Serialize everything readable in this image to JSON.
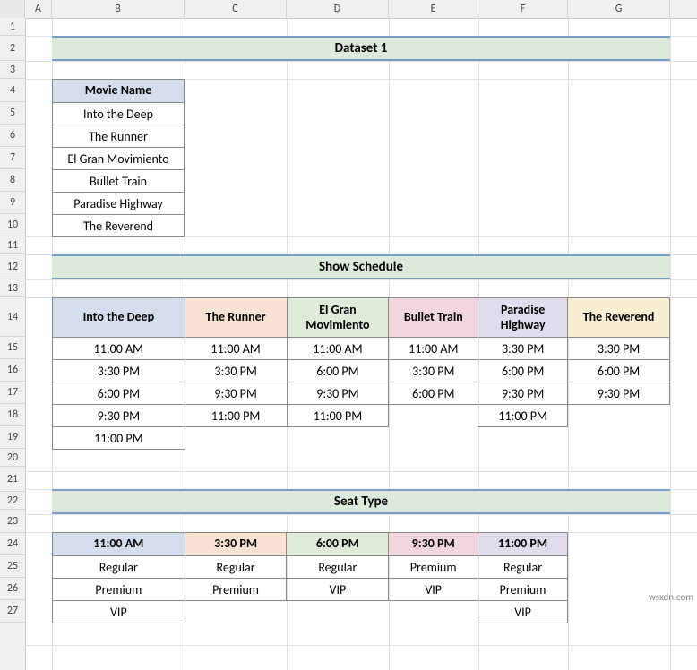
{
  "columns": [
    "A",
    "B",
    "C",
    "D",
    "E",
    "F",
    "G"
  ],
  "rows": [
    "1",
    "2",
    "3",
    "4",
    "5",
    "6",
    "7",
    "8",
    "9",
    "10",
    "11",
    "12",
    "13",
    "14",
    "15",
    "16",
    "17",
    "18",
    "19",
    "20",
    "21",
    "22",
    "23",
    "24",
    "25",
    "26",
    "27"
  ],
  "section1": {
    "title": "Dataset 1"
  },
  "movieNameHeader": "Movie Name",
  "movies": [
    "Into the Deep",
    "The Runner",
    "El Gran Movimiento",
    "Bullet Train",
    "Paradise Highway",
    "The Reverend"
  ],
  "section2": {
    "title": "Show Schedule"
  },
  "schedule": {
    "headers": [
      "Into the Deep",
      "The Runner",
      "El Gran Movimiento",
      "Bullet Train",
      "Paradise Highway",
      "The Reverend"
    ],
    "rows": [
      [
        "11:00 AM",
        "11:00 AM",
        "11:00 AM",
        "11:00 AM",
        "3:30 PM",
        "3:30 PM"
      ],
      [
        "3:30 PM",
        "3:30 PM",
        "6:00 PM",
        "3:30 PM",
        "6:00 PM",
        "6:00 PM"
      ],
      [
        "6:00 PM",
        "9:30 PM",
        "9:30 PM",
        "6:00 PM",
        "9:30 PM",
        "9:30 PM"
      ],
      [
        "9:30 PM",
        "11:00 PM",
        "11:00 PM",
        "",
        "11:00 PM",
        ""
      ],
      [
        "11:00 PM",
        "",
        "",
        "",
        "",
        ""
      ]
    ]
  },
  "section3": {
    "title": "Seat Type"
  },
  "seatType": {
    "headers": [
      "11:00 AM",
      "3:30 PM",
      "6:00 PM",
      "9:30 PM",
      "11:00 PM"
    ],
    "rows": [
      [
        "Regular",
        "Regular",
        "Regular",
        "Premium",
        "Regular"
      ],
      [
        "Premium",
        "Premium",
        "VIP",
        "VIP",
        "Premium"
      ],
      [
        "VIP",
        "",
        "",
        "",
        "VIP"
      ]
    ]
  },
  "colWidths": {
    "A": 30,
    "B": 148,
    "C": 114,
    "D": 114,
    "E": 100,
    "F": 100,
    "G": 114
  },
  "watermark": "wsxdn.com"
}
